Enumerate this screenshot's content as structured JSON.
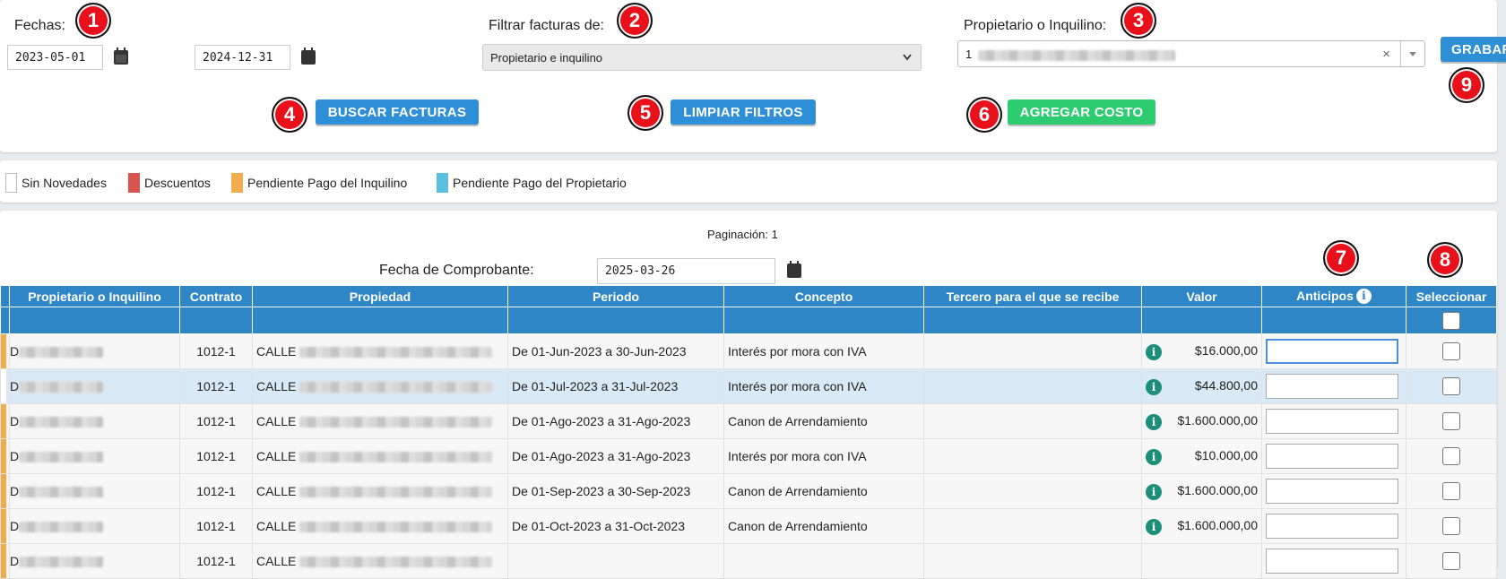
{
  "filters": {
    "fechas_label": "Fechas:",
    "fecha_inicio": "2023-05-01",
    "fecha_fin": "2024-12-31",
    "filtrar_label": "Filtrar facturas de:",
    "filtrar_value": "Propietario e inquilino",
    "propietario_label": "Propietario o Inquilino:",
    "propietario_value": "1",
    "propietario_clear": "×"
  },
  "buttons": {
    "buscar": "BUSCAR FACTURAS",
    "limpiar": "LIMPIAR FILTROS",
    "agregar": "AGREGAR COSTO",
    "grabar": "GRABAR"
  },
  "badges": [
    "1",
    "2",
    "3",
    "4",
    "5",
    "6",
    "7",
    "8",
    "9"
  ],
  "legend": [
    {
      "label": "Sin Novedades",
      "color": "#ffffff"
    },
    {
      "label": "Descuentos",
      "color": "#d9534f"
    },
    {
      "label": "Pendiente Pago del Inquilino",
      "color": "#f0ad4e"
    },
    {
      "label": "Pendiente Pago del Propietario",
      "color": "#5bc0de"
    }
  ],
  "pagination": "Paginación: 1",
  "fecha_comprobante_label": "Fecha de Comprobante:",
  "fecha_comprobante": "2025-03-26",
  "table": {
    "headers": {
      "propietario": "Propietario o Inquilino",
      "contrato": "Contrato",
      "propiedad": "Propiedad",
      "periodo": "Periodo",
      "concepto": "Concepto",
      "tercero": "Tercero para el que se recibe",
      "valor": "Valor",
      "anticipos": "Anticipos",
      "seleccionar": "Seleccionar"
    },
    "rows": [
      {
        "prefix": "D",
        "contrato": "1012-1",
        "propiedad": "CALLE",
        "periodo": "De 01-Jun-2023 a 30-Jun-2023",
        "concepto": "Interés por mora con IVA",
        "valor": "$16.000,00",
        "stripe": "#f0ad4e"
      },
      {
        "prefix": "D",
        "contrato": "1012-1",
        "propiedad": "CALLE",
        "periodo": "De 01-Jul-2023 a 31-Jul-2023",
        "concepto": "Interés por mora con IVA",
        "valor": "$44.800,00",
        "stripe": "#ffffff"
      },
      {
        "prefix": "D",
        "contrato": "1012-1",
        "propiedad": "CALLE",
        "periodo": "De 01-Ago-2023 a 31-Ago-2023",
        "concepto": "Canon de Arrendamiento",
        "valor": "$1.600.000,00",
        "stripe": "#f0ad4e"
      },
      {
        "prefix": "D",
        "contrato": "1012-1",
        "propiedad": "CALLE",
        "periodo": "De 01-Ago-2023 a 31-Ago-2023",
        "concepto": "Interés por mora con IVA",
        "valor": "$10.000,00",
        "stripe": "#f0ad4e"
      },
      {
        "prefix": "D",
        "contrato": "1012-1",
        "propiedad": "CALLE",
        "periodo": "De 01-Sep-2023 a 30-Sep-2023",
        "concepto": "Canon de Arrendamiento",
        "valor": "$1.600.000,00",
        "stripe": "#f0ad4e"
      },
      {
        "prefix": "D",
        "contrato": "1012-1",
        "propiedad": "CALLE",
        "periodo": "De 01-Oct-2023 a 31-Oct-2023",
        "concepto": "Canon de Arrendamiento",
        "valor": "$1.600.000,00",
        "stripe": "#f0ad4e"
      },
      {
        "prefix": "D",
        "contrato": "1012-1",
        "propiedad": "CALLE",
        "periodo": "",
        "concepto": "",
        "valor": "",
        "stripe": "#f0ad4e"
      }
    ]
  }
}
